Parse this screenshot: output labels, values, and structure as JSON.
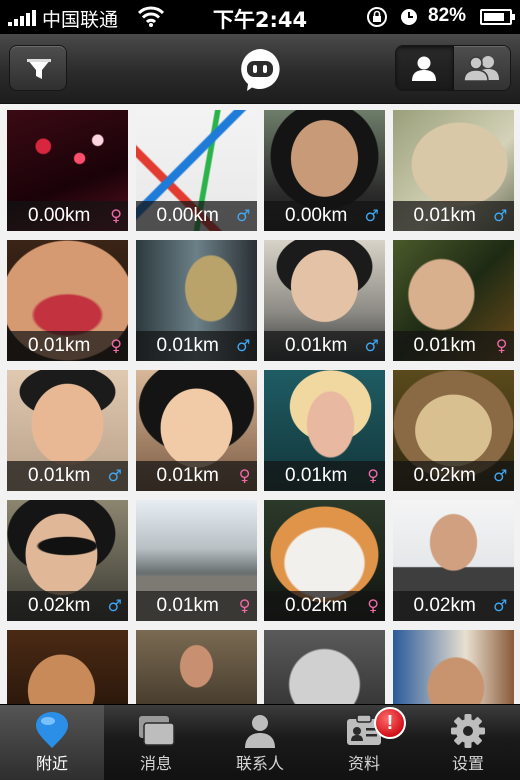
{
  "status_bar": {
    "carrier": "中国联通",
    "time": "下午2:44",
    "battery_percent": "82%",
    "battery_level": 0.82
  },
  "nav": {
    "filter_icon": "funnel-icon",
    "logo_icon": "chat-bubble-logo-icon",
    "segments": [
      {
        "icon": "single-person-icon",
        "selected": true
      },
      {
        "icon": "group-people-icon",
        "selected": false
      }
    ]
  },
  "users": [
    {
      "distance": "0.00km",
      "sex": "♀",
      "gender": "female"
    },
    {
      "distance": "0.00km",
      "sex": "♂",
      "gender": "male"
    },
    {
      "distance": "0.00km",
      "sex": "♂",
      "gender": "male"
    },
    {
      "distance": "0.01km",
      "sex": "♂",
      "gender": "male"
    },
    {
      "distance": "0.01km",
      "sex": "♀",
      "gender": "female"
    },
    {
      "distance": "0.01km",
      "sex": "♂",
      "gender": "male"
    },
    {
      "distance": "0.01km",
      "sex": "♂",
      "gender": "male"
    },
    {
      "distance": "0.01km",
      "sex": "♀",
      "gender": "female"
    },
    {
      "distance": "0.01km",
      "sex": "♂",
      "gender": "male"
    },
    {
      "distance": "0.01km",
      "sex": "♀",
      "gender": "female"
    },
    {
      "distance": "0.01km",
      "sex": "♀",
      "gender": "female"
    },
    {
      "distance": "0.02km",
      "sex": "♂",
      "gender": "male"
    },
    {
      "distance": "0.02km",
      "sex": "♂",
      "gender": "male"
    },
    {
      "distance": "0.01km",
      "sex": "♀",
      "gender": "female"
    },
    {
      "distance": "0.02km",
      "sex": "♀",
      "gender": "female"
    },
    {
      "distance": "0.02km",
      "sex": "♂",
      "gender": "male"
    },
    {
      "distance": "",
      "sex": "",
      "gender": ""
    },
    {
      "distance": "",
      "sex": "",
      "gender": ""
    },
    {
      "distance": "",
      "sex": "",
      "gender": ""
    },
    {
      "distance": "",
      "sex": "",
      "gender": ""
    }
  ],
  "tabs": [
    {
      "label": "附近",
      "icon": "location-pin-icon",
      "active": true
    },
    {
      "label": "消息",
      "icon": "messages-icon",
      "active": false
    },
    {
      "label": "联系人",
      "icon": "contacts-icon",
      "active": false
    },
    {
      "label": "资料",
      "icon": "profile-card-icon",
      "active": false,
      "badge": "!"
    },
    {
      "label": "设置",
      "icon": "gear-icon",
      "active": false
    }
  ],
  "colors": {
    "male": "#3fa9f5",
    "female": "#f06aa8",
    "active_tab_icon": "#2b8fe8",
    "badge": "#d1111a"
  }
}
